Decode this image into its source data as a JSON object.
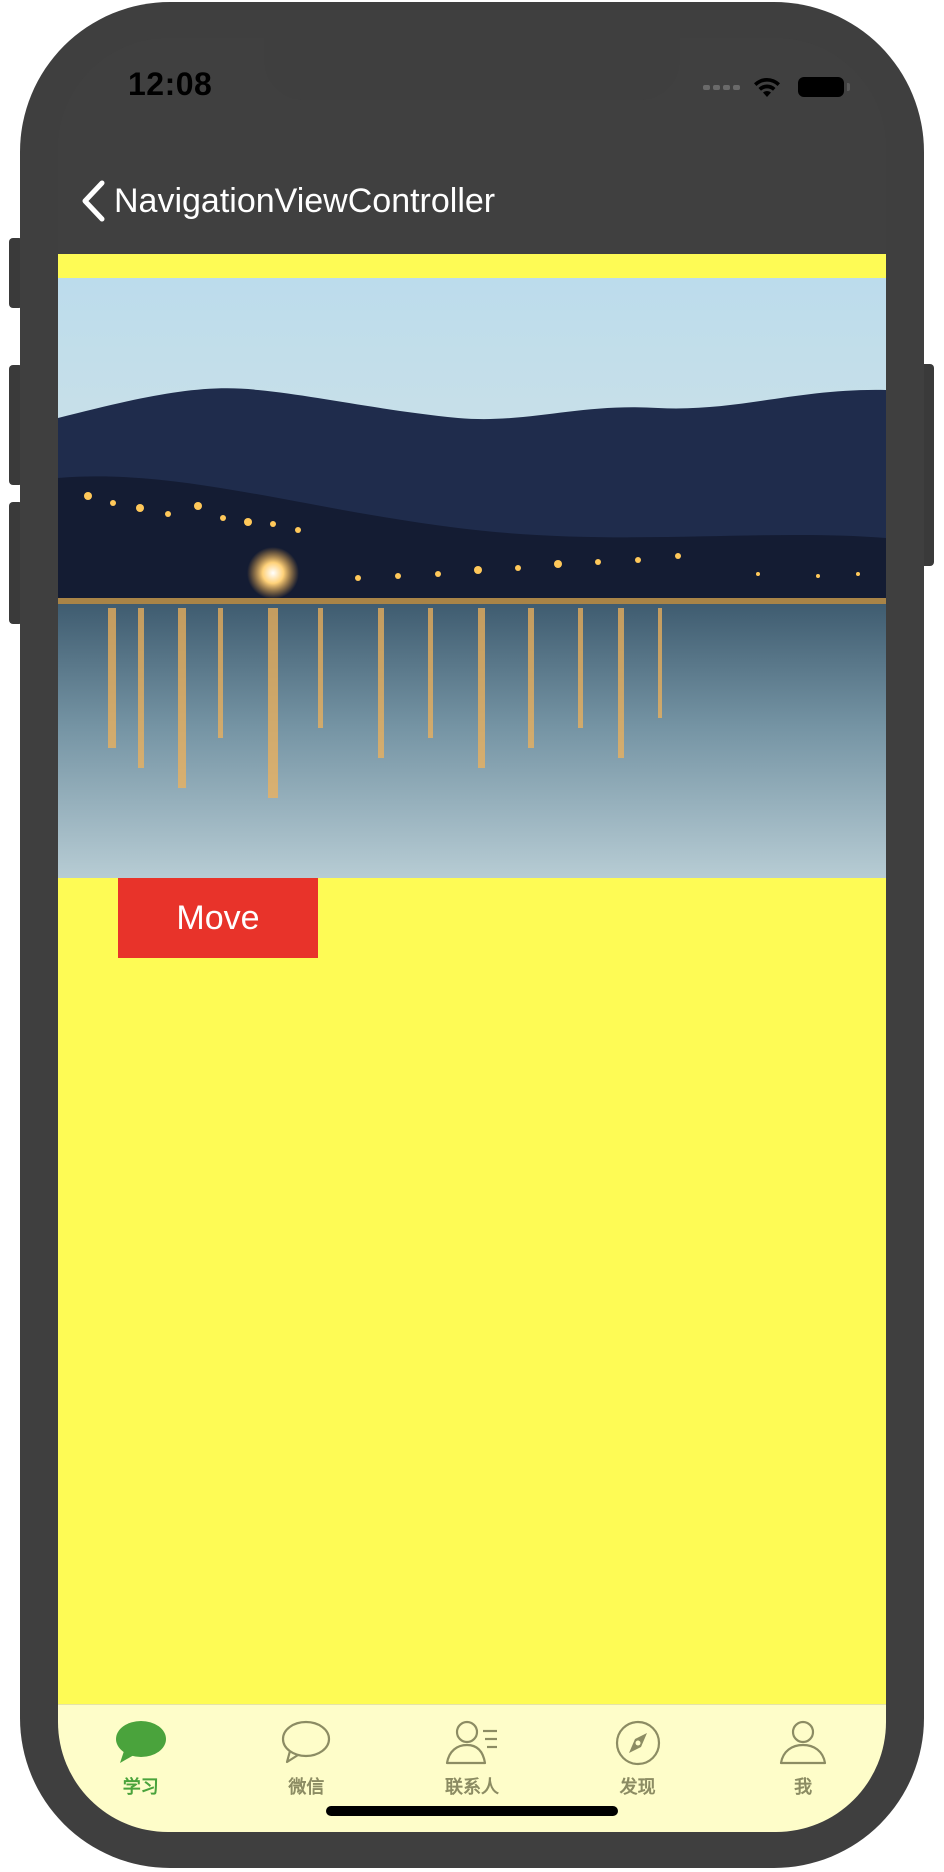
{
  "status_bar": {
    "time": "12:08"
  },
  "nav_bar": {
    "back_icon": "chevron-left-icon",
    "title": "NavigationViewController"
  },
  "content": {
    "background_color": "#fefb55",
    "image_description_icon": "lake-night-photo",
    "move_button_label": "Move",
    "move_button_color": "#e8332a"
  },
  "tab_bar": {
    "background_color": "#fefdc9",
    "active_color": "#4aa33c",
    "inactive_color": "#8c8c63",
    "items": [
      {
        "label": "学习",
        "icon": "chat-bubble-filled-icon",
        "active": true
      },
      {
        "label": "微信",
        "icon": "chat-bubble-outline-icon",
        "active": false
      },
      {
        "label": "联系人",
        "icon": "contacts-icon",
        "active": false
      },
      {
        "label": "发现",
        "icon": "compass-icon",
        "active": false
      },
      {
        "label": "我",
        "icon": "person-icon",
        "active": false
      }
    ]
  }
}
